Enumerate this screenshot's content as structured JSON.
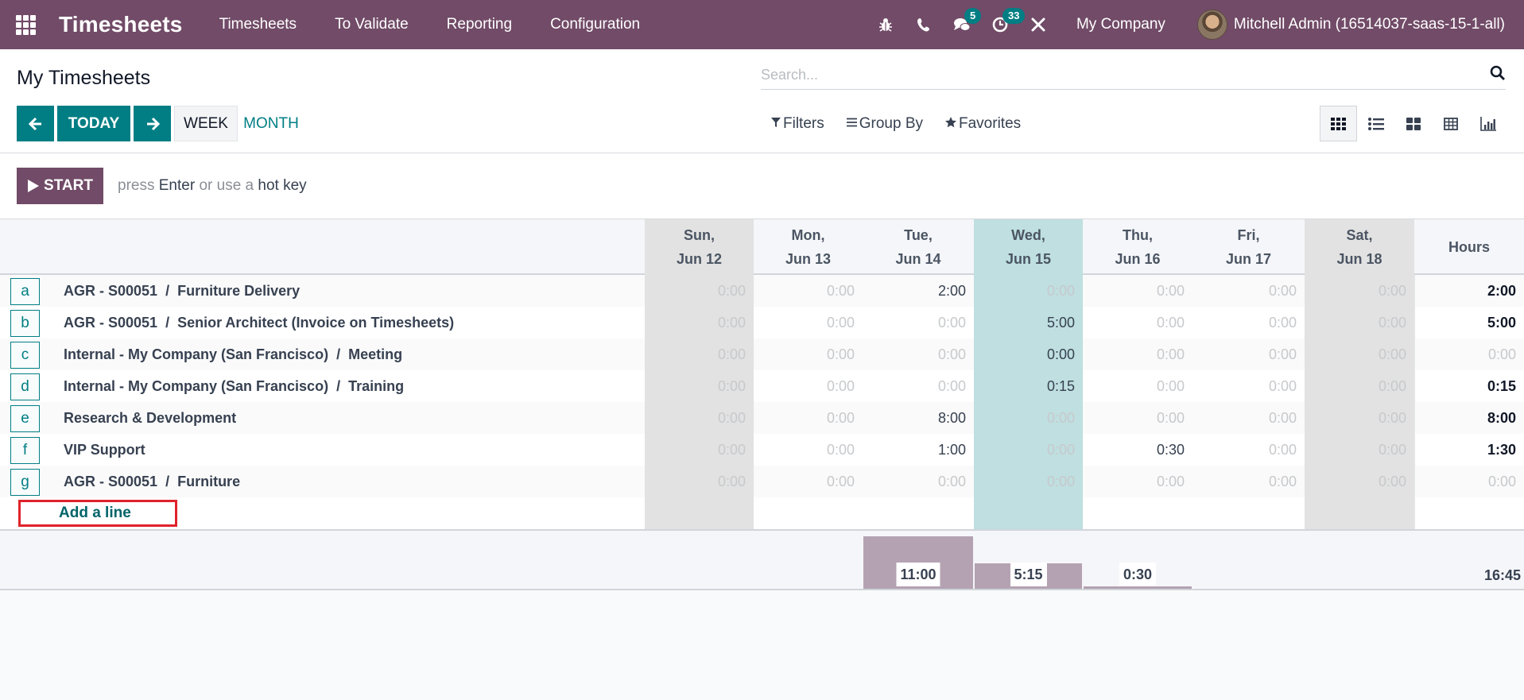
{
  "navbar": {
    "app_name": "Timesheets",
    "menu": [
      "Timesheets",
      "To Validate",
      "Reporting",
      "Configuration"
    ],
    "icons": [
      {
        "name": "bug-icon",
        "glyph": "🐞"
      },
      {
        "name": "phone-icon",
        "glyph": "✆"
      },
      {
        "name": "chat-icon",
        "glyph": "💬",
        "badge": "5"
      },
      {
        "name": "activity-clock-icon",
        "glyph": "◔",
        "badge": "33"
      },
      {
        "name": "tools-icon",
        "glyph": "✕"
      }
    ],
    "company": "My Company",
    "user": "Mitchell Admin (16514037-saas-15-1-all)"
  },
  "control": {
    "title": "My Timesheets",
    "search_placeholder": "Search...",
    "prev_label": "🡐",
    "today_label": "TODAY",
    "next_label": "🡒",
    "week_label": "WEEK",
    "month_label": "MONTH",
    "filters_label": "Filters",
    "groupby_label": "Group By",
    "favorites_label": "Favorites",
    "views": [
      "grid",
      "list",
      "kanban",
      "pivot",
      "graph"
    ],
    "active_view": "grid"
  },
  "timer": {
    "start_label": "START",
    "hint_parts": [
      "press ",
      "Enter",
      " or use a ",
      "hot key"
    ]
  },
  "grid": {
    "columns": [
      {
        "day": "Sun,",
        "date": "Jun 12",
        "kind": "weekend"
      },
      {
        "day": "Mon,",
        "date": "Jun 13",
        "kind": "normal"
      },
      {
        "day": "Tue,",
        "date": "Jun 14",
        "kind": "normal"
      },
      {
        "day": "Wed,",
        "date": "Jun 15",
        "kind": "today"
      },
      {
        "day": "Thu,",
        "date": "Jun 16",
        "kind": "normal"
      },
      {
        "day": "Fri,",
        "date": "Jun 17",
        "kind": "normal"
      },
      {
        "day": "Sat,",
        "date": "Jun 18",
        "kind": "weekend"
      }
    ],
    "hours_label": "Hours",
    "rows": [
      {
        "key": "a",
        "project": "AGR - S00051",
        "task": "Furniture Delivery",
        "values": [
          "0:00",
          "0:00",
          "2:00",
          "0:00",
          "0:00",
          "0:00",
          "0:00"
        ],
        "total": "2:00"
      },
      {
        "key": "b",
        "project": "AGR - S00051",
        "task": "Senior Architect (Invoice on Timesheets)",
        "values": [
          "0:00",
          "0:00",
          "0:00",
          "5:00",
          "0:00",
          "0:00",
          "0:00"
        ],
        "total": "5:00"
      },
      {
        "key": "c",
        "project": "Internal - My Company (San Francisco)",
        "task": "Meeting",
        "values": [
          "0:00",
          "0:00",
          "0:00",
          "0:00",
          "0:00",
          "0:00",
          "0:00"
        ],
        "total": "0:00",
        "set": [
          3
        ]
      },
      {
        "key": "d",
        "project": "Internal - My Company (San Francisco)",
        "task": "Training",
        "values": [
          "0:00",
          "0:00",
          "0:00",
          "0:15",
          "0:00",
          "0:00",
          "0:00"
        ],
        "total": "0:15"
      },
      {
        "key": "e",
        "project": "Research & Development",
        "task": "",
        "values": [
          "0:00",
          "0:00",
          "8:00",
          "0:00",
          "0:00",
          "0:00",
          "0:00"
        ],
        "total": "8:00"
      },
      {
        "key": "f",
        "project": "VIP Support",
        "task": "",
        "values": [
          "0:00",
          "0:00",
          "1:00",
          "0:00",
          "0:30",
          "0:00",
          "0:00"
        ],
        "total": "1:30"
      },
      {
        "key": "g",
        "project": "AGR - S00051",
        "task": "Furniture",
        "values": [
          "0:00",
          "0:00",
          "0:00",
          "0:00",
          "0:00",
          "0:00",
          "0:00"
        ],
        "total": "0:00"
      }
    ],
    "add_line_label": "Add a line",
    "daily_totals": [
      "",
      "",
      "11:00",
      "5:15",
      "0:30",
      "",
      ""
    ],
    "daily_totals_hours": [
      0,
      0,
      11,
      5.25,
      0.5,
      0,
      0
    ],
    "grand_total": "16:45"
  }
}
